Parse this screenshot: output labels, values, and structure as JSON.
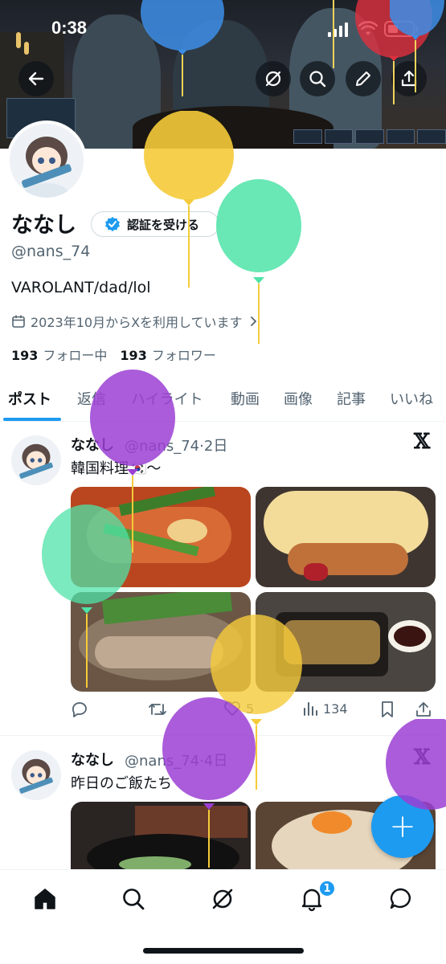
{
  "status_bar": {
    "time": "0:38"
  },
  "profile": {
    "display_name": "ななし",
    "verify_label": "認証を受ける",
    "handle": "@nans_74",
    "bio": "VAROLANT/dad/lol",
    "joined": "2023年10月からXを利用しています",
    "following_count": "193",
    "following_label": "フォロー中",
    "followers_count": "193",
    "followers_label": "フォロワー"
  },
  "tabs": [
    {
      "label": "ポスト",
      "active": true
    },
    {
      "label": "返信"
    },
    {
      "label": "ハイライト"
    },
    {
      "label": "動画"
    },
    {
      "label": "画像"
    },
    {
      "label": "記事"
    },
    {
      "label": "いいね"
    }
  ],
  "tweets": [
    {
      "name": "ななし",
      "handle": "@nans_74",
      "time": "2日",
      "text": "韓国料理🇰🇷〜",
      "likes": "5",
      "views": "134"
    },
    {
      "name": "ななし",
      "handle": "@nans_74",
      "time": "4日",
      "text": "昨日のご飯たち"
    }
  ],
  "nav": {
    "notification_badge": "1"
  },
  "fab_label": "+",
  "icons": {
    "back": "arrow-left-icon",
    "grok": "grok-icon",
    "search": "search-icon",
    "edit": "pencil-icon",
    "share": "share-icon",
    "calendar": "calendar-icon",
    "verified": "verified-badge-icon",
    "x": "x-logo-icon",
    "reply": "reply-icon",
    "retweet": "retweet-icon",
    "like": "heart-icon",
    "views": "views-icon",
    "bookmark": "bookmark-icon",
    "home": "home-icon",
    "bell": "bell-icon",
    "messages": "messages-icon"
  },
  "colors": {
    "accent": "#1d9bf0",
    "text": "#0f1419",
    "secondary": "#536471"
  },
  "time_separator": "·"
}
